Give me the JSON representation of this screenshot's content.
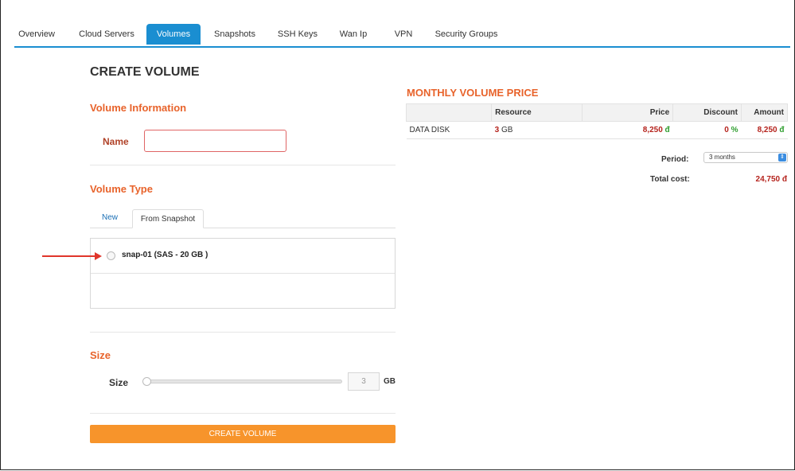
{
  "tabs": [
    {
      "label": "Overview"
    },
    {
      "label": "Cloud Servers"
    },
    {
      "label": "Volumes"
    },
    {
      "label": "Snapshots"
    },
    {
      "label": "SSH Keys"
    },
    {
      "label": "Wan Ip"
    },
    {
      "label": "VPN"
    },
    {
      "label": "Security Groups"
    }
  ],
  "active_tab": "Volumes",
  "form": {
    "title": "CREATE VOLUME",
    "volume_info_heading": "Volume Information",
    "name_label": "Name",
    "name_value": "",
    "volume_type_heading": "Volume Type",
    "type_tabs": [
      {
        "label": "New"
      },
      {
        "label": "From Snapshot"
      }
    ],
    "active_type_tab": "From Snapshot",
    "snapshots": [
      {
        "label": "snap-01 (SAS - 20 GB )",
        "selected": false
      }
    ],
    "size_heading": "Size",
    "size_label": "Size",
    "size_value": "3",
    "size_unit": "GB",
    "create_button": "CREATE VOLUME"
  },
  "price": {
    "title": "MONTHLY VOLUME PRICE",
    "headers": {
      "resource": "Resource",
      "price": "Price",
      "discount": "Discount",
      "amount": "Amount"
    },
    "row": {
      "name": "DATA DISK",
      "resource_qty": "3",
      "resource_unit": "GB",
      "price": "8,250",
      "currency": "đ",
      "discount_value": "0",
      "discount_unit": "%",
      "amount": "8,250"
    },
    "period_label": "Period:",
    "period_value": "3 months",
    "total_label": "Total cost:",
    "total_value": "24,750 đ"
  },
  "colors": {
    "accent_blue": "#1a8ed1",
    "heading_orange": "#e8632b",
    "button_orange": "#f7942b",
    "price_red": "#b5231d",
    "discount_green": "#2f9e2f",
    "annotation_arrow": "#e0362b"
  }
}
